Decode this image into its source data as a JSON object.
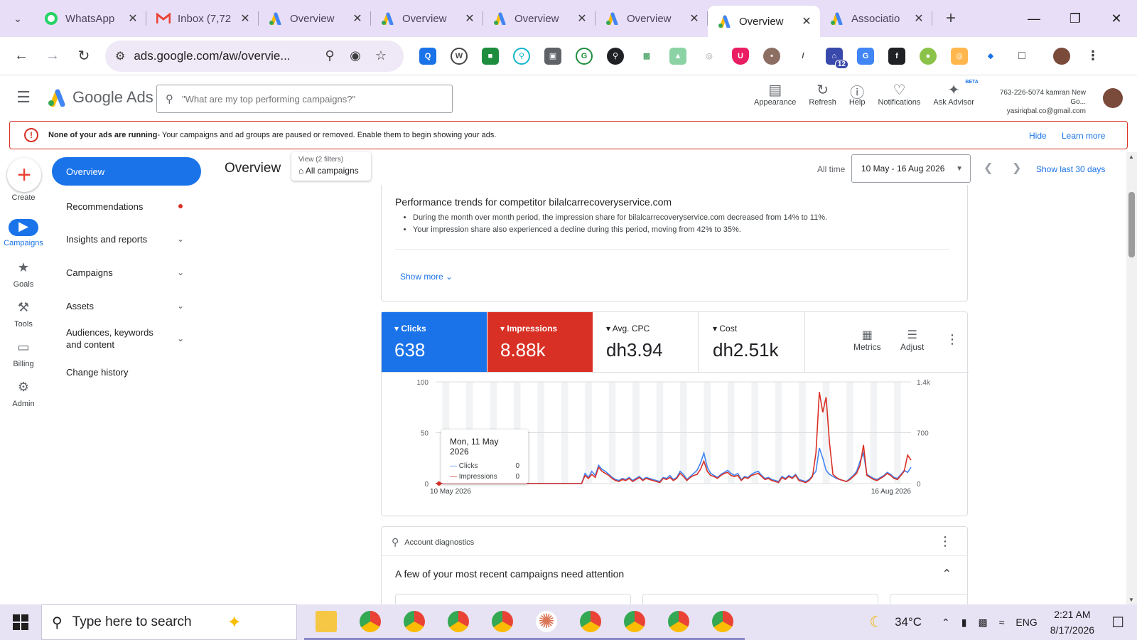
{
  "browser": {
    "tabs": [
      {
        "label": "WhatsApp",
        "icon": "whatsapp-icon",
        "active": false
      },
      {
        "label": "Inbox (7,72",
        "icon": "gmail-icon",
        "active": false
      },
      {
        "label": "Overview",
        "icon": "google-ads-icon",
        "active": false
      },
      {
        "label": "Overview",
        "icon": "google-ads-icon",
        "active": false
      },
      {
        "label": "Overview",
        "icon": "google-ads-icon",
        "active": false
      },
      {
        "label": "Overview",
        "icon": "google-ads-icon",
        "active": false
      },
      {
        "label": "Overview",
        "icon": "google-ads-icon",
        "active": true
      },
      {
        "label": "Associatio",
        "icon": "google-ads-icon",
        "active": false
      }
    ],
    "url": "ads.google.com/aw/overvie...",
    "extension_badge": "12"
  },
  "header": {
    "product_name": "Google Ads",
    "search_placeholder": "\"What are my top performing campaigns?\"",
    "tools": [
      {
        "label": "Appearance",
        "icon": "appearance-icon"
      },
      {
        "label": "Refresh",
        "icon": "refresh-icon"
      },
      {
        "label": "Help",
        "icon": "help-icon"
      },
      {
        "label": "Notifications",
        "icon": "bell-icon"
      },
      {
        "label": "Ask Advisor",
        "icon": "advisor-icon"
      }
    ],
    "beta_badge": "BETA",
    "account_line1": "763-226-5074 kamran New Go...",
    "account_line2": "yasiriqbal.co@gmail.com"
  },
  "alert": {
    "bold": "None of your ads are running",
    "text": " - Your campaigns and ad groups are paused or removed. Enable them to begin showing your ads.",
    "hide": "Hide",
    "learn": "Learn more"
  },
  "rail": {
    "create": "Create",
    "items": [
      "Campaigns",
      "Goals",
      "Tools",
      "Billing",
      "Admin"
    ]
  },
  "nav": {
    "items": [
      "Overview",
      "Recommendations",
      "Insights and reports",
      "Campaigns",
      "Assets",
      "Audiences, keywords and content",
      "Change history"
    ]
  },
  "overview": {
    "title": "Overview",
    "view_filters": "View (2 filters)",
    "view_value": "All campaigns",
    "all_time": "All time",
    "date_range": "10 May - 16 Aug 2026",
    "show_last": "Show last 30 days"
  },
  "trends": {
    "title": "Performance trends for competitor bilalcarrecoveryservice.com",
    "bullets": [
      "During the month over month period, the impression share for bilalcarrecoveryservice.com decreased from 14% to 11%.",
      "Your impression share also experienced a decline during this period, moving from 42% to 35%."
    ],
    "show_more": "Show more"
  },
  "kpis": [
    {
      "label": "Clicks",
      "value": "638"
    },
    {
      "label": "Impressions",
      "value": "8.88k"
    },
    {
      "label": "Avg. CPC",
      "value": "dh3.94"
    },
    {
      "label": "Cost",
      "value": "dh2.51k"
    }
  ],
  "chart_tools": {
    "metrics": "Metrics",
    "adjust": "Adjust"
  },
  "chart_data": {
    "type": "line",
    "x_start_label": "10 May 2026",
    "x_end_label": "16 Aug 2026",
    "y_left_ticks": [
      "100",
      "50",
      "0"
    ],
    "y_right_ticks": [
      "1.4k",
      "700",
      "0"
    ],
    "ylim_left": [
      0,
      100
    ],
    "ylim_right": [
      0,
      1400
    ],
    "series": [
      {
        "name": "Clicks",
        "color": "#4285f4",
        "values": [
          0,
          0,
          0,
          0,
          0,
          0,
          0,
          0,
          0,
          0,
          0,
          0,
          0,
          0,
          0,
          0,
          0,
          0,
          0,
          0,
          0,
          0,
          0,
          0,
          0,
          0,
          0,
          0,
          0,
          0,
          0,
          0,
          0,
          0,
          0,
          0,
          0,
          0,
          0,
          0,
          0,
          0,
          0,
          0,
          10,
          6,
          12,
          8,
          18,
          14,
          12,
          9,
          6,
          4,
          3,
          5,
          4,
          6,
          3,
          5,
          7,
          4,
          6,
          5,
          4,
          3,
          2,
          6,
          5,
          8,
          4,
          6,
          12,
          9,
          4,
          7,
          10,
          13,
          20,
          30,
          16,
          10,
          8,
          6,
          9,
          11,
          13,
          10,
          8,
          10,
          4,
          7,
          6,
          9,
          11,
          12,
          8,
          5,
          6,
          4,
          3,
          2,
          7,
          5,
          8,
          6,
          9,
          4,
          3,
          2,
          4,
          8,
          12,
          35,
          25,
          13,
          9,
          7,
          5,
          4,
          3,
          2,
          5,
          8,
          12,
          22,
          30,
          9,
          7,
          5,
          4,
          6,
          8,
          11,
          9,
          6,
          5,
          9,
          13,
          11,
          16
        ]
      },
      {
        "name": "Impressions",
        "color": "#d93025",
        "values": [
          0,
          0,
          0,
          0,
          0,
          0,
          0,
          0,
          0,
          0,
          0,
          0,
          0,
          0,
          0,
          0,
          0,
          0,
          0,
          0,
          0,
          0,
          0,
          0,
          0,
          0,
          0,
          0,
          0,
          0,
          0,
          0,
          0,
          0,
          0,
          0,
          0,
          0,
          0,
          0,
          0,
          0,
          0,
          0,
          8,
          5,
          9,
          6,
          16,
          12,
          10,
          8,
          5,
          3,
          2,
          4,
          3,
          5,
          2,
          4,
          6,
          3,
          5,
          4,
          3,
          2,
          1,
          5,
          4,
          6,
          3,
          5,
          10,
          7,
          3,
          6,
          8,
          9,
          14,
          22,
          12,
          8,
          7,
          5,
          8,
          10,
          11,
          8,
          7,
          8,
          3,
          6,
          5,
          8,
          9,
          10,
          7,
          4,
          5,
          3,
          2,
          1,
          6,
          4,
          7,
          5,
          8,
          3,
          2,
          1,
          3,
          7,
          30,
          90,
          70,
          85,
          40,
          9,
          6,
          4,
          3,
          2,
          4,
          7,
          10,
          18,
          38,
          8,
          6,
          4,
          3,
          5,
          7,
          10,
          8,
          5,
          4,
          8,
          12,
          28,
          23
        ]
      }
    ],
    "tooltip": {
      "date": "Mon, 11 May 2026",
      "clicks_label": "Clicks",
      "clicks_value": "0",
      "impr_label": "Impressions",
      "impr_value": "0"
    }
  },
  "diagnostics": {
    "head": "Account diagnostics",
    "title": "A few of your most recent campaigns need attention"
  },
  "taskbar": {
    "search": "Type here to search",
    "temperature": "34°C",
    "lang": "ENG",
    "time": "2:21 AM",
    "date": "8/17/2026"
  }
}
